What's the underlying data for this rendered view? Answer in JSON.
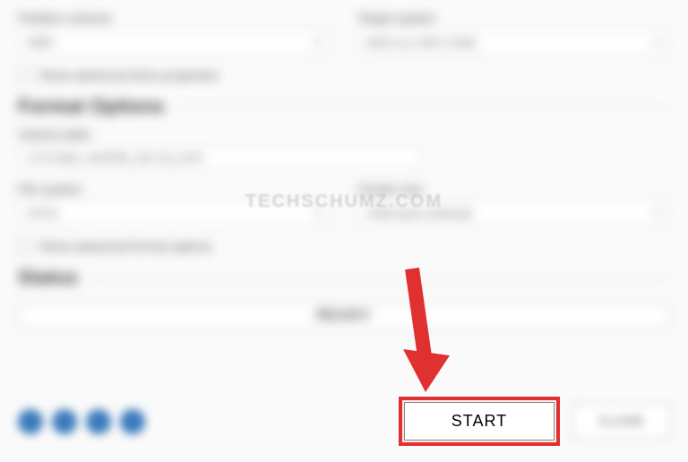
{
  "top_left_label": "Partition scheme",
  "top_left_value": "MBR",
  "top_right_label": "Target system",
  "top_right_value": "BIOS (or UEFI-CSM)",
  "show_drive_props": "Show advanced drive properties",
  "format_section": "Format Options",
  "volume_label": "Volume label",
  "volume_value": "CCCOMA_X64FRE_EN-US_DV9",
  "fs_label": "File system",
  "fs_value": "NTFS",
  "cluster_label": "Cluster size",
  "cluster_value": "4096 bytes (Default)",
  "show_format_opts": "Show advanced format options",
  "status_section": "Status",
  "status_text": "READY",
  "start_label": "START",
  "close_label": "CLOSE",
  "watermark": "TECHSCHUMZ.COM"
}
